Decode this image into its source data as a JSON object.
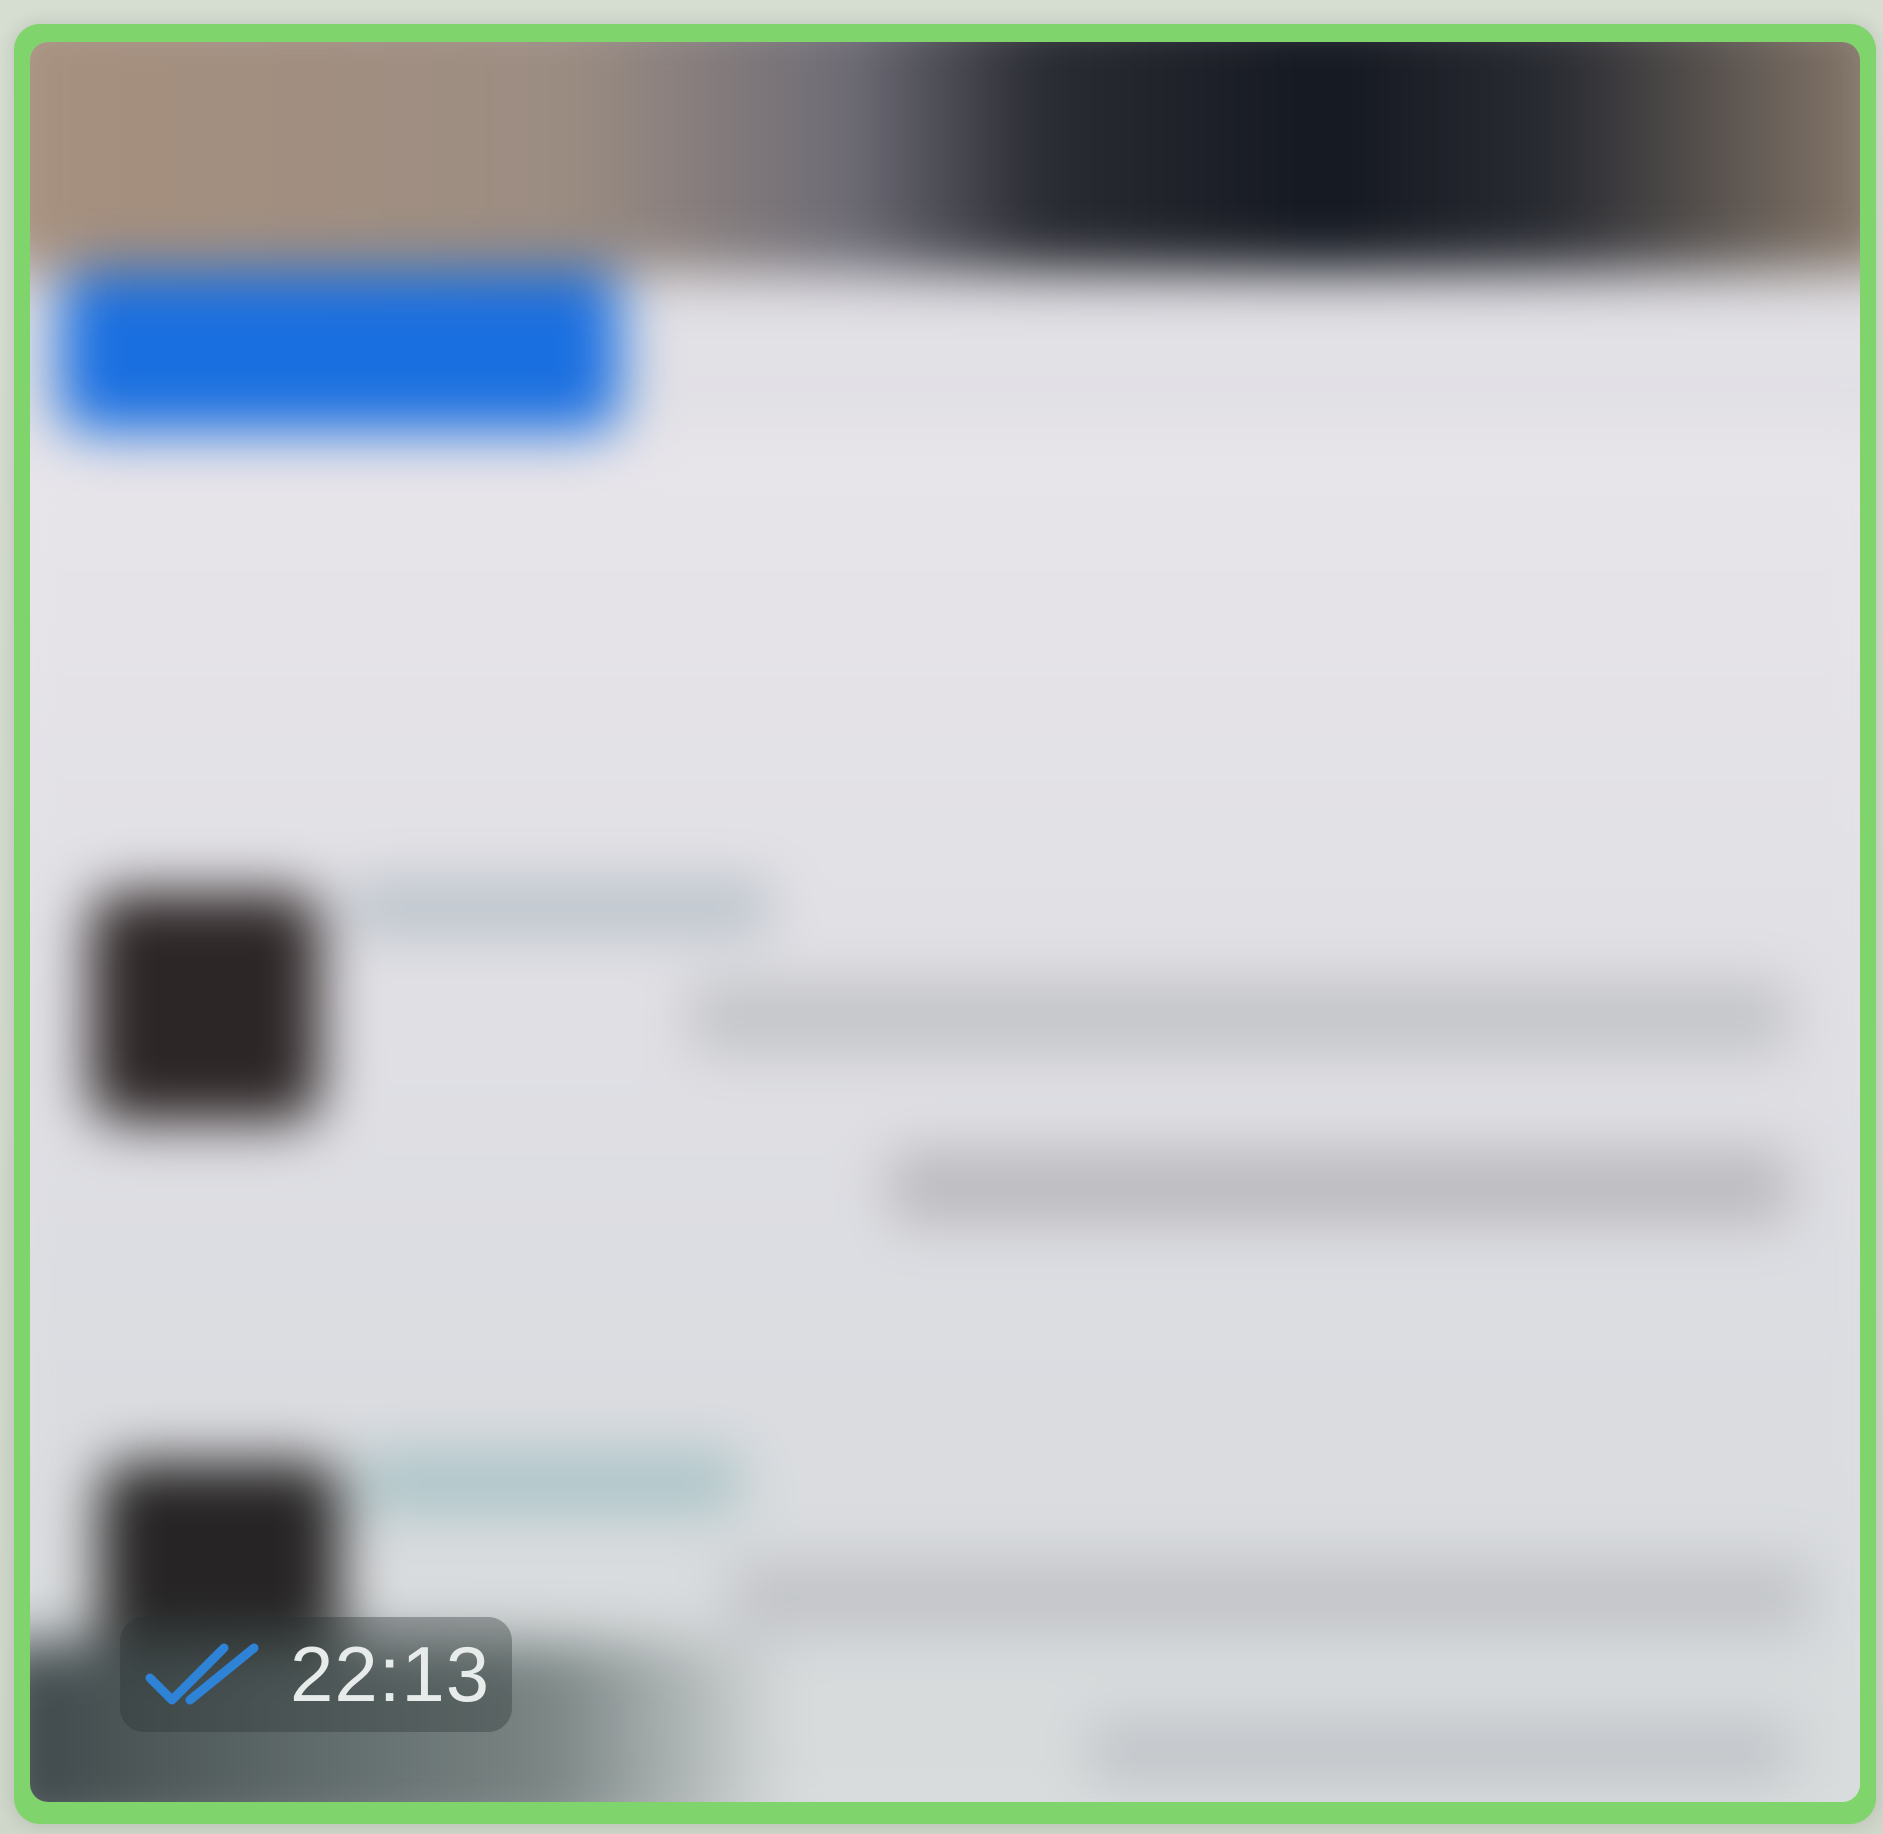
{
  "message": {
    "time": "22:13",
    "status_icon": "double-check-icon",
    "colors": {
      "bubble": "#7fd46b",
      "check": "#2f83d6",
      "time_text": "#e7eceb"
    }
  }
}
